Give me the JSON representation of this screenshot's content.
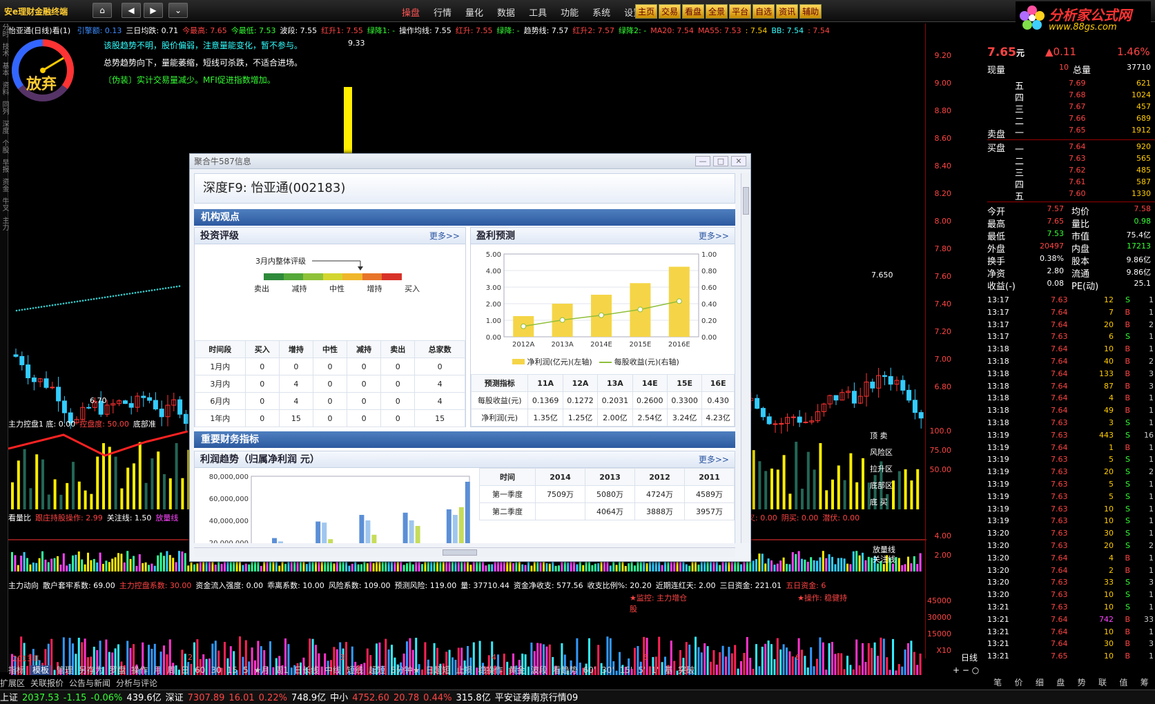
{
  "app": {
    "title": "安e理财金融终端",
    "menu": [
      "操盘",
      "行情",
      "量化",
      "数据",
      "工具",
      "功能",
      "系统",
      "设置"
    ],
    "menu_active": 0,
    "quick_buttons": [
      "主页",
      "交易",
      "看盘",
      "全景",
      "平台",
      "自选",
      "资讯",
      "辅助"
    ],
    "brand_name": "分析家公式网",
    "brand_url": "www.88gs.com"
  },
  "chart": {
    "stock_line": "怡亚通(日线)看(1)",
    "info": [
      {
        "t": "引擎额: 0.13",
        "c": "#3c8cff"
      },
      {
        "t": "三日均跌: 0.71",
        "c": "#ffffff"
      },
      {
        "t": "今最高: 7.65",
        "c": "#ff4444"
      },
      {
        "t": "今最低: 7.53",
        "c": "#33ff33"
      },
      {
        "t": "波段: 7.55",
        "c": "#ffffff"
      },
      {
        "t": "红升1: 7.55",
        "c": "#ff4444"
      },
      {
        "t": "绿降1: -",
        "c": "#33ff33"
      },
      {
        "t": "操作均线: 7.55",
        "c": "#ffffff"
      },
      {
        "t": "红升: 7.55",
        "c": "#ff4444"
      },
      {
        "t": "绿降: -",
        "c": "#33ff33"
      },
      {
        "t": "趋势线: 7.57",
        "c": "#ffffff"
      },
      {
        "t": "红升2: 7.57",
        "c": "#ff4444"
      },
      {
        "t": "绿降2: -",
        "c": "#33ff33"
      },
      {
        "t": "MA20: 7.54",
        "c": "#ff4444"
      },
      {
        "t": "MA55: 7.53",
        "c": "#ff4444"
      },
      {
        "t": ": 7.54",
        "c": "#ffcc00"
      },
      {
        "t": "BB: 7.54",
        "c": "#33ffff"
      },
      {
        "t": ": 7.54",
        "c": "#ff4444"
      }
    ],
    "gauge_label": "放弃",
    "notes": [
      {
        "t": "该股趋势不明，股价偏弱，注意量能变化，暂不参与。",
        "c": "#33ffff"
      },
      {
        "t": "总势趋势向下，量能萎缩，短线可杀跌，不适合进场。",
        "c": "#ffffff"
      },
      {
        "t": "〔伪装〕实计交易量减少。MFI促进指数增加。",
        "c": "#33ff33"
      }
    ],
    "high_label": "9.33",
    "low_label": "6.70",
    "last_label": "7.650",
    "axis_prices": [
      "9.20",
      "9.00",
      "8.80",
      "8.60",
      "8.40",
      "8.20",
      "8.00",
      "7.80",
      "7.60",
      "7.40",
      "7.20",
      "7.00",
      "6.80"
    ],
    "ind1_line": [
      {
        "t": "主力控盘1 底: 0.00",
        "c": "#ffffff"
      },
      {
        "t": "控盘度: 50.00",
        "c": "#ff4444"
      },
      {
        "t": "底部准",
        "c": "#ffffff"
      }
    ],
    "ind1_right": [
      "顶 卖",
      "风险区",
      "拉升区",
      "底部区",
      "底 买"
    ],
    "ind1_axis": [
      "100.0",
      "75.00",
      "50.00"
    ],
    "ind2_line": [
      {
        "t": "看量比",
        "c": "#ffffff"
      },
      {
        "t": "跟庄持股操作: 2.99",
        "c": "#ff4444"
      },
      {
        "t": "关注线: 1.50",
        "c": "#ffffff"
      },
      {
        "t": "放量线",
        "c": "#ff44ff"
      }
    ],
    "ind2_mid": [
      {
        "t": "金叉: 0.00",
        "c": "#ff4444"
      },
      {
        "t": "阴买: 0.00",
        "c": "#ff4444"
      },
      {
        "t": "潜伏: 0.00",
        "c": "#ff4444"
      }
    ],
    "ind2_right": [
      "放量线",
      "关注线"
    ],
    "ind2_axis": [
      "4.00",
      "2.00"
    ],
    "ind3_line": [
      {
        "t": "主力动向",
        "c": "#ffffff"
      },
      {
        "t": "散户套牢系数: 69.00",
        "c": "#ffffff"
      },
      {
        "t": "主力控盘系数: 30.00",
        "c": "#ff4444"
      },
      {
        "t": "资金流入强度: 0.00",
        "c": "#ffffff"
      },
      {
        "t": "乖离系数: 10.00",
        "c": "#ffffff"
      },
      {
        "t": "风险系数: 109.00",
        "c": "#ffffff"
      },
      {
        "t": "预测风险: 119.00",
        "c": "#ffffff"
      },
      {
        "t": "量: 37710.44",
        "c": "#ffffff"
      },
      {
        "t": "资金净收支: 577.56",
        "c": "#ffffff"
      },
      {
        "t": "收支比例%: 20.20",
        "c": "#ffffff"
      },
      {
        "t": "近期连红天: 2.00",
        "c": "#ffffff"
      },
      {
        "t": "三日资金: 221.01",
        "c": "#ffffff"
      },
      {
        "t": "五日资金: 6",
        "c": "#ff4444"
      }
    ],
    "ind3_tags": [
      "★监控: 主力增仓",
      "★操作: 稳健持股"
    ],
    "ind3_axis": [
      "45000",
      "30000",
      "15000",
      "X10"
    ],
    "year_label": "2013年",
    "month_labels": [
      "2",
      "3",
      "4",
      "5",
      "6"
    ],
    "period_label": "日线"
  },
  "bottom": {
    "tabs": [
      "指标",
      "模板",
      "管理",
      "另存为",
      "罗盘",
      "操作",
      "月",
      "周",
      "日",
      "60",
      "30",
      "15",
      "5",
      "★月",
      "周1",
      "日长线",
      "中线",
      "短线",
      "超短",
      "5分钟★",
      "日超短",
      "止损",
      "稳操作",
      "黄金",
      "波段",
      "看趋势",
      "60'",
      "30'",
      "15'",
      "5'",
      "1'",
      "基",
      "突破"
    ],
    "tab_active": 1,
    "tabs2": [
      "扩展区",
      "关联报价",
      "公告与新闻",
      "分析与评论"
    ],
    "status": [
      {
        "t": "上证",
        "c": "#ffffff"
      },
      {
        "t": "2037.53",
        "c": "#33ff33"
      },
      {
        "t": "-1.15",
        "c": "#33ff33"
      },
      {
        "t": "-0.06%",
        "c": "#33ff33"
      },
      {
        "t": "439.6亿",
        "c": "#ffffff"
      },
      {
        "t": "深证",
        "c": "#ffffff"
      },
      {
        "t": "7307.89",
        "c": "#ff4444"
      },
      {
        "t": "16.01",
        "c": "#ff4444"
      },
      {
        "t": "0.22%",
        "c": "#ff4444"
      },
      {
        "t": "748.9亿",
        "c": "#ffffff"
      },
      {
        "t": "中小",
        "c": "#ffffff"
      },
      {
        "t": "4752.60",
        "c": "#ff4444"
      },
      {
        "t": "20.78",
        "c": "#ff4444"
      },
      {
        "t": "0.44%",
        "c": "#ff4444"
      },
      {
        "t": "315.8亿",
        "c": "#ffffff"
      },
      {
        "t": "平安证券南京行情09",
        "c": "#ffffff"
      }
    ]
  },
  "quote": {
    "price": "7.65",
    "unit": "元",
    "change": "▲0.11",
    "pct": "1.46%",
    "now_vol_label": "现量",
    "now_vol": "10",
    "total_vol_label": "总量",
    "total_vol": "37710",
    "sells": [
      {
        "l": "五",
        "p": "7.69",
        "v": "621"
      },
      {
        "l": "四",
        "p": "7.68",
        "v": "1024"
      },
      {
        "l": "三",
        "p": "7.67",
        "v": "457"
      },
      {
        "l": "二",
        "p": "7.66",
        "v": "689"
      },
      {
        "l": "一",
        "p": "7.65",
        "v": "1912"
      }
    ],
    "sell_label": "卖盘",
    "buy_label": "买盘",
    "buys": [
      {
        "l": "一",
        "p": "7.64",
        "v": "920"
      },
      {
        "l": "二",
        "p": "7.63",
        "v": "565"
      },
      {
        "l": "三",
        "p": "7.62",
        "v": "485"
      },
      {
        "l": "四",
        "p": "7.61",
        "v": "587"
      },
      {
        "l": "五",
        "p": "7.60",
        "v": "1330"
      }
    ],
    "stats": [
      {
        "a": "今开",
        "av": "7.57",
        "ac": "#ff4444",
        "b": "均价",
        "bv": "7.58",
        "bc": "#ff4444"
      },
      {
        "a": "最高",
        "av": "7.65",
        "ac": "#ff4444",
        "b": "量比",
        "bv": "0.98",
        "bc": "#33ff33"
      },
      {
        "a": "最低",
        "av": "7.53",
        "ac": "#33ff33",
        "b": "市值",
        "bv": "75.4亿",
        "bc": "#ffffff"
      },
      {
        "a": "外盘",
        "av": "20497",
        "ac": "#ff4444",
        "b": "内盘",
        "bv": "17213",
        "bc": "#33ff33"
      },
      {
        "a": "换手",
        "av": "0.38%",
        "ac": "#ffffff",
        "b": "股本",
        "bv": "9.86亿",
        "bc": "#ffffff"
      },
      {
        "a": "净资",
        "av": "2.80",
        "ac": "#ffffff",
        "b": "流通",
        "bv": "9.86亿",
        "bc": "#ffffff"
      },
      {
        "a": "收益(-)",
        "av": "0.08",
        "ac": "#ffffff",
        "b": "PE(动)",
        "bv": "25.1",
        "bc": "#ffffff"
      }
    ],
    "ticks": [
      {
        "t": "13:17",
        "p": "7.63",
        "v": "12",
        "s": "S",
        "n": "1"
      },
      {
        "t": "13:17",
        "p": "7.64",
        "v": "7",
        "s": "B",
        "n": "1"
      },
      {
        "t": "13:17",
        "p": "7.64",
        "v": "20",
        "s": "B",
        "n": "2"
      },
      {
        "t": "13:17",
        "p": "7.63",
        "v": "6",
        "s": "S",
        "n": "1"
      },
      {
        "t": "13:18",
        "p": "7.64",
        "v": "10",
        "s": "B",
        "n": "1"
      },
      {
        "t": "13:18",
        "p": "7.64",
        "v": "40",
        "s": "B",
        "n": "2"
      },
      {
        "t": "13:18",
        "p": "7.64",
        "v": "133",
        "s": "B",
        "n": "3"
      },
      {
        "t": "13:18",
        "p": "7.64",
        "v": "87",
        "s": "B",
        "n": "3"
      },
      {
        "t": "13:18",
        "p": "7.64",
        "v": "4",
        "s": "B",
        "n": "1"
      },
      {
        "t": "13:18",
        "p": "7.64",
        "v": "49",
        "s": "B",
        "n": "1"
      },
      {
        "t": "13:18",
        "p": "7.63",
        "v": "3",
        "s": "S",
        "n": "1"
      },
      {
        "t": "13:19",
        "p": "7.63",
        "v": "443",
        "s": "S",
        "n": "16"
      },
      {
        "t": "13:19",
        "p": "7.64",
        "v": "1",
        "s": "B",
        "n": "1"
      },
      {
        "t": "13:19",
        "p": "7.63",
        "v": "5",
        "s": "S",
        "n": "1"
      },
      {
        "t": "13:19",
        "p": "7.63",
        "v": "20",
        "s": "S",
        "n": "2"
      },
      {
        "t": "13:19",
        "p": "7.63",
        "v": "5",
        "s": "S",
        "n": "1"
      },
      {
        "t": "13:19",
        "p": "7.63",
        "v": "5",
        "s": "S",
        "n": "1"
      },
      {
        "t": "13:19",
        "p": "7.63",
        "v": "10",
        "s": "S",
        "n": "1"
      },
      {
        "t": "13:19",
        "p": "7.63",
        "v": "10",
        "s": "S",
        "n": "1"
      },
      {
        "t": "13:20",
        "p": "7.63",
        "v": "30",
        "s": "S",
        "n": "1"
      },
      {
        "t": "13:20",
        "p": "7.63",
        "v": "20",
        "s": "S",
        "n": "2"
      },
      {
        "t": "13:20",
        "p": "7.64",
        "v": "4",
        "s": "B",
        "n": "1"
      },
      {
        "t": "13:20",
        "p": "7.64",
        "v": "2",
        "s": "B",
        "n": "1"
      },
      {
        "t": "13:20",
        "p": "7.63",
        "v": "33",
        "s": "S",
        "n": "3"
      },
      {
        "t": "13:20",
        "p": "7.63",
        "v": "10",
        "s": "S",
        "n": "1"
      },
      {
        "t": "13:21",
        "p": "7.63",
        "v": "10",
        "s": "S",
        "n": "1"
      },
      {
        "t": "13:21",
        "p": "7.64",
        "v": "742",
        "s": "B",
        "n": "33"
      },
      {
        "t": "13:21",
        "p": "7.64",
        "v": "10",
        "s": "B",
        "n": "1"
      },
      {
        "t": "13:21",
        "p": "7.64",
        "v": "30",
        "s": "B",
        "n": "3"
      },
      {
        "t": "13:21",
        "p": "7.65",
        "v": "10",
        "s": "B",
        "n": "1"
      }
    ],
    "tabs": [
      "笔",
      "价",
      "细",
      "盘",
      "势",
      "联",
      "值",
      "筹"
    ]
  },
  "dialog": {
    "title": "聚合牛587信息",
    "header": "深度F9: 怡亚通(002183)",
    "section1": "机构观点",
    "rating": {
      "title": "投资评级",
      "more": "更多>>",
      "scale_title": "3月内整体评级",
      "scale": [
        "卖出",
        "减持",
        "中性",
        "增持",
        "买入"
      ],
      "table_head": [
        "时间段",
        "买入",
        "增持",
        "中性",
        "减持",
        "卖出",
        "总家数"
      ],
      "rows": [
        [
          "1月内",
          "0",
          "0",
          "0",
          "0",
          "0",
          "0"
        ],
        [
          "3月内",
          "0",
          "4",
          "0",
          "0",
          "0",
          "4"
        ],
        [
          "6月内",
          "0",
          "4",
          "0",
          "0",
          "0",
          "4"
        ],
        [
          "1年内",
          "0",
          "15",
          "0",
          "0",
          "0",
          "15"
        ]
      ]
    },
    "forecast": {
      "title": "盈利预测",
      "more": "更多>>",
      "legend_bar": "净利润(亿元)(左轴)",
      "legend_line": "每股收益(元)(右轴)",
      "table_head": [
        "预测指标",
        "11A",
        "12A",
        "13A",
        "14E",
        "15E",
        "16E"
      ],
      "rows": [
        [
          "每股收益(元)",
          "0.1369",
          "0.1272",
          "0.2031",
          "0.2600",
          "0.3300",
          "0.430"
        ],
        [
          "净利润(元)",
          "1.35亿",
          "1.25亿",
          "2.00亿",
          "2.54亿",
          "3.24亿",
          "4.23亿"
        ]
      ]
    },
    "section2": "重要财务指标",
    "profit": {
      "title": "利润趋势（归属净利润 元）",
      "more": "更多>>",
      "table_head": [
        "时间",
        "2014",
        "2013",
        "2012",
        "2011"
      ],
      "rows": [
        [
          "第一季度",
          "7509万",
          "5080万",
          "4724万",
          "4589万"
        ],
        [
          "第二季度",
          "",
          "4064万",
          "3888万",
          "3957万"
        ]
      ]
    }
  },
  "chart_data": [
    {
      "type": "bar",
      "title": "盈利预测",
      "categories": [
        "2012A",
        "2013A",
        "2014E",
        "2015E",
        "2016E"
      ],
      "series": [
        {
          "name": "净利润(亿元)(左轴)",
          "values": [
            1.25,
            2.0,
            2.54,
            3.24,
            4.23
          ],
          "axis": "left",
          "color": "#f5d547"
        },
        {
          "name": "每股收益(元)(右轴)",
          "values": [
            0.1272,
            0.2031,
            0.26,
            0.33,
            0.43
          ],
          "axis": "right",
          "type": "line",
          "color": "#8fbf3a"
        }
      ],
      "ylim": [
        0,
        5
      ],
      "y2lim": [
        0,
        1
      ],
      "yticks": [
        "5.00",
        "4.00",
        "3.00",
        "2.00",
        "1.00",
        "0.00"
      ],
      "y2ticks": [
        "1.00",
        "0.80",
        "0.60",
        "0.40",
        "0.20",
        "0.00"
      ]
    },
    {
      "type": "bar",
      "title": "利润趋势（归属净利润 元）",
      "yticks": [
        "80,000,000",
        "60,000,000",
        "40,000,000",
        "20,000,000"
      ],
      "ylim": [
        20000000,
        80000000
      ],
      "groups": [
        [
          24000000,
          21000000,
          0
        ],
        [
          39000000,
          38000000,
          23000000
        ],
        [
          45000000,
          40000000,
          27000000
        ],
        [
          47000000,
          40000000,
          35000000
        ],
        [
          50000000,
          45000000,
          52000000,
          75000000
        ]
      ],
      "group_colors": [
        "#5b8fd6",
        "#9fc6ee",
        "#c6dc5a",
        "#5b8fd6"
      ]
    }
  ]
}
